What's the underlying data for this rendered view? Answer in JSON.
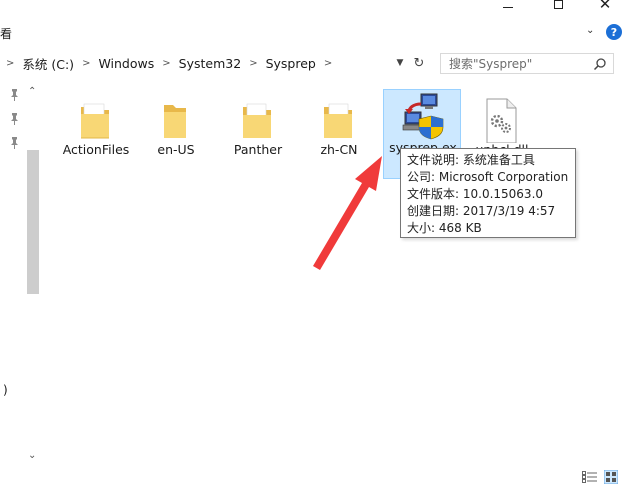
{
  "ribbon": {
    "tab_fragment": "看"
  },
  "address": {
    "crumbs": [
      "系统 (C:)",
      "Windows",
      "System32",
      "Sysprep"
    ],
    "search_placeholder": "搜索\"Sysprep\""
  },
  "nav_pane": {
    "partial_text": ")"
  },
  "files": [
    {
      "name": "ActionFiles",
      "type": "folder"
    },
    {
      "name": "en-US",
      "type": "folder"
    },
    {
      "name": "Panther",
      "type": "folder"
    },
    {
      "name": "zh-CN",
      "type": "folder"
    },
    {
      "name": "sysprep.exe",
      "label_line1": "sysprep.ex",
      "label_line2": "e",
      "type": "exe",
      "selected": true
    },
    {
      "name": "unbcl.dll",
      "type": "dll"
    }
  ],
  "tooltip": {
    "line1": "文件说明: 系统准备工具",
    "line2": "公司: Microsoft Corporation",
    "line3": "文件版本: 10.0.15063.0",
    "line4": "创建日期: 2017/3/19 4:57",
    "line5": "大小: 468 KB"
  },
  "colors": {
    "selection": "#cce8ff",
    "arrow": "#f03a3a",
    "help": "#1c6fd6",
    "folder": "#f8d775"
  }
}
